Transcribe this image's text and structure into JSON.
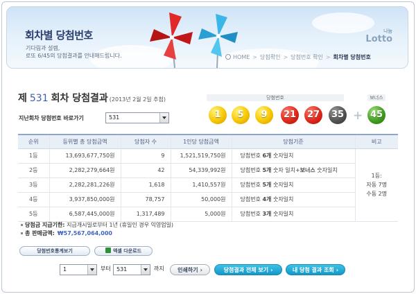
{
  "header": {
    "title": "회차별 당첨번호",
    "desc_line1": "기다림과 설렘,",
    "desc_line2": "로또 6/45의 당첨결과를 안내해드립니다.",
    "logo_small": "나눔",
    "logo_big": "Lotto"
  },
  "breadcrumb": [
    "HOME",
    "당첨확인",
    "당첨번호 확인",
    "회차별 당첨번호"
  ],
  "draw": {
    "prefix": "제",
    "number": "531",
    "suffix": "회차 당첨결과",
    "date": "(2013년 2월 2일 추첨)"
  },
  "prev_round": {
    "label": "지난회차 당첨번호 바로가기",
    "value": "531"
  },
  "balls": {
    "winning_label": "당첨번호",
    "bonus_label": "보너스",
    "numbers": [
      "1",
      "5",
      "9",
      "21",
      "27",
      "35"
    ],
    "bonus": "45",
    "colors": {
      "yellow": "#f7c600",
      "red": "#e0281b",
      "gray": "#545454",
      "green": "#3f9e1f"
    }
  },
  "table": {
    "headers": [
      "순위",
      "등위별 총 당첨금액",
      "당첨자 수",
      "1인당 당첨금액",
      "당첨기준",
      "비고"
    ],
    "rows": [
      {
        "rank": "1등",
        "total": "13,693,677,750원",
        "winners": "9",
        "per": "1,521,519,750원",
        "crit_a": "당첨번호 ",
        "crit_b": "6개",
        "crit_c": " 숫자일치"
      },
      {
        "rank": "2등",
        "total": "2,282,279,664원",
        "winners": "42",
        "per": "54,339,992원",
        "crit_a": "당첨번호 ",
        "crit_b": "5개",
        "crit_c": " 숫자 일치+",
        "crit_d": "보너스",
        "crit_e": " 숫자일치"
      },
      {
        "rank": "3등",
        "total": "2,282,281,226원",
        "winners": "1,618",
        "per": "1,410,557원",
        "crit_a": "당첨번호 ",
        "crit_b": "5개",
        "crit_c": " 숫자일치"
      },
      {
        "rank": "4등",
        "total": "3,937,850,000원",
        "winners": "78,757",
        "per": "50,000원",
        "crit_a": "당첨번호 ",
        "crit_b": "4개",
        "crit_c": " 숫자일치"
      },
      {
        "rank": "5등",
        "total": "6,587,445,000원",
        "winners": "1,317,489",
        "per": "5,000원",
        "crit_a": "당첨번호 ",
        "crit_b": "3개",
        "crit_c": " 숫자일치"
      }
    ],
    "note_line1": "1등:",
    "note_line2": "자동 7명",
    "note_line3": "수동 2명"
  },
  "info": {
    "payout_label": "당첨금 지급기한:",
    "payout_value": "지급개시일로부터 1년 (휴일인 경우 익영업일)",
    "sales_label": "총 판매금액:",
    "sales_value": "₩57,567,064,000"
  },
  "buttons": {
    "stats": "당첨번호통계보기",
    "excel": "엑셀 다운로드",
    "print": "인쇄하기",
    "view_all": "당첨결과 전체 보기",
    "my_result": "내 당첨 결과 조회"
  },
  "range": {
    "from_value": "1",
    "from_label": "부터",
    "to_value": "531",
    "to_label": "까지"
  }
}
